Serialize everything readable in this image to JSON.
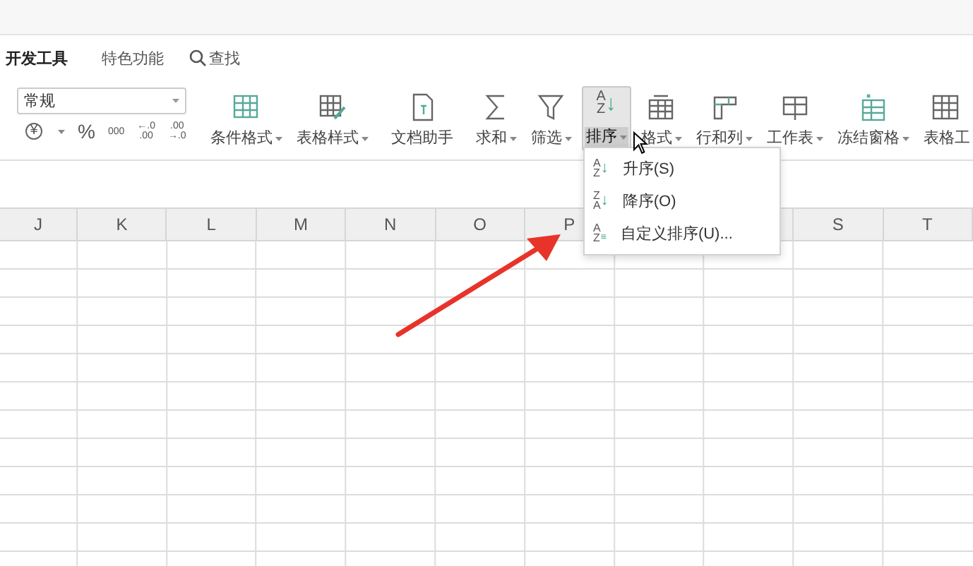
{
  "tabs": [
    {
      "label": "开发工具",
      "selected": true
    },
    {
      "label": "特色功能",
      "selected": false
    }
  ],
  "search": {
    "label": "查找"
  },
  "number_format": {
    "value": "常规"
  },
  "number_buttons": [
    {
      "kind": "currency",
      "lines": [
        "¥"
      ]
    },
    {
      "kind": "percent",
      "lines": [
        "%"
      ]
    },
    {
      "kind": "thousands",
      "lines": [
        "000"
      ]
    },
    {
      "kind": "decimal",
      "lines": [
        "←.0",
        ".00"
      ]
    },
    {
      "kind": "decimal",
      "lines": [
        ".00",
        "→.0"
      ]
    }
  ],
  "ribbon": [
    {
      "label": "条件格式",
      "kind": "conditional",
      "dropdown": true,
      "selected": false
    },
    {
      "label": "表格样式",
      "kind": "style",
      "dropdown": true,
      "selected": false
    },
    {
      "label": "文档助手",
      "kind": "document",
      "dropdown": false,
      "selected": false
    },
    {
      "label": "求和",
      "kind": "sum",
      "dropdown": true,
      "selected": false
    },
    {
      "label": "筛选",
      "kind": "filter",
      "dropdown": true,
      "selected": false
    },
    {
      "label": "排序",
      "kind": "sort",
      "glyphs": [
        "A",
        "Z",
        "↓"
      ],
      "dropdown": true,
      "selected": true
    },
    {
      "label": "格式",
      "kind": "format",
      "dropdown": true,
      "selected": false
    },
    {
      "label": "行和列",
      "kind": "rowcol",
      "dropdown": true,
      "selected": false
    },
    {
      "label": "工作表",
      "kind": "sheet",
      "dropdown": true,
      "selected": false
    },
    {
      "label": "冻结窗格",
      "kind": "freeze",
      "dropdown": true,
      "selected": false
    },
    {
      "label": "表格工",
      "kind": "tools",
      "dropdown": false,
      "selected": false
    }
  ],
  "columns": [
    "J",
    "K",
    "L",
    "M",
    "N",
    "O",
    "P",
    null,
    null,
    "S",
    "T"
  ],
  "sort_menu": {
    "items": [
      {
        "kind": "ascending",
        "glyphs": [
          "A",
          "Z",
          "↓"
        ],
        "label": "升序(S)"
      },
      {
        "kind": "descending",
        "glyphs": [
          "Z",
          "A",
          "↓"
        ],
        "label": "降序(O)"
      },
      {
        "kind": "custom",
        "glyphs": [
          "A",
          "Z",
          "≡"
        ],
        "label": "自定义排序(U)..."
      }
    ]
  }
}
